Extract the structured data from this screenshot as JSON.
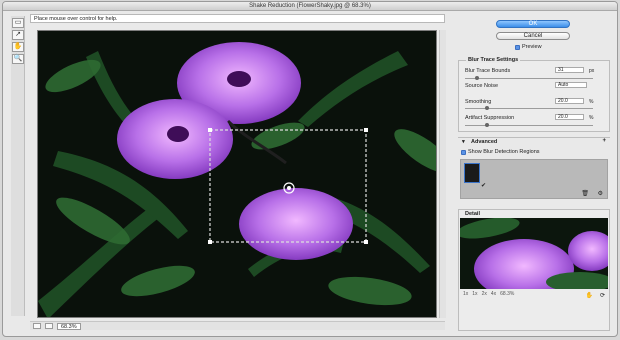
{
  "window": {
    "title": "Shake Reduction (FlowerShaky.jpg @ 68.3%)"
  },
  "toolbar": {
    "hint": "Place mouse over control for help."
  },
  "status": {
    "zoom": "68.3%"
  },
  "buttons": {
    "ok": "OK",
    "cancel": "Cancel"
  },
  "preview": {
    "label": "Preview"
  },
  "blur": {
    "title": "Blur Trace Settings",
    "bounds_label": "Blur Trace Bounds",
    "bounds_value": "31",
    "bounds_unit": "px",
    "noise_label": "Source Noise",
    "noise_value": "Auto",
    "smooth_label": "Smoothing",
    "smooth_value": "20.0",
    "smooth_unit": "%",
    "artifact_label": "Artifact Suppression",
    "artifact_value": "20.0",
    "artifact_unit": "%"
  },
  "advanced": {
    "title": "Advanced",
    "show_label": "Show Blur Detection Regions"
  },
  "detail": {
    "title": "Detail",
    "zooms": [
      "1x",
      "1x",
      "2x",
      "4x",
      "68.3%"
    ]
  },
  "colors": {
    "accent": "#3c8ee8",
    "flower": "#b46ad8",
    "leaf": "#275f2c"
  }
}
